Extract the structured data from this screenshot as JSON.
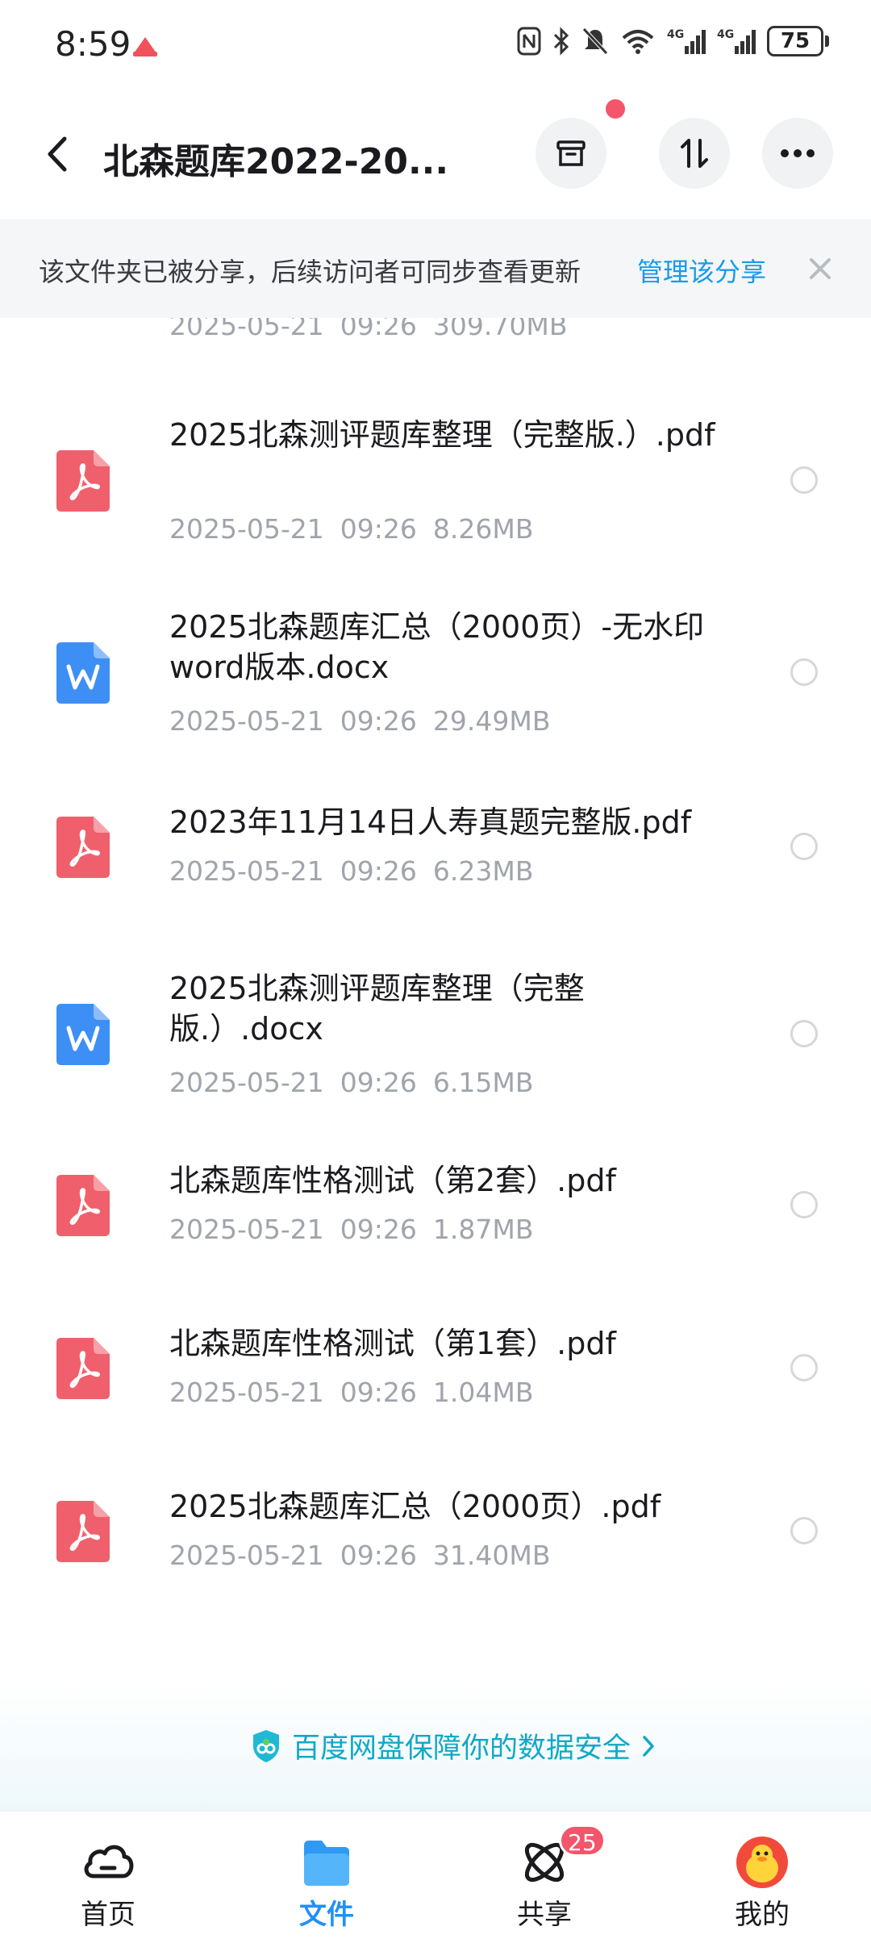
{
  "status_bar": {
    "time": "8:59",
    "battery": "75",
    "net1": "4G",
    "net2": "4G"
  },
  "header": {
    "title": "北森题库2022-20..."
  },
  "share_banner": {
    "text": "该文件夹已被分享，后续访问者可同步查看更新",
    "manage_label": "管理该分享"
  },
  "files": [
    {
      "type": "pdf",
      "name": "",
      "date": "2025-05-21",
      "time": "09:26",
      "size": "309.70MB"
    },
    {
      "type": "pdf",
      "name": "2025北森测评题库整理（完整版.）.pdf",
      "date": "2025-05-21",
      "time": "09:26",
      "size": "8.26MB"
    },
    {
      "type": "docx",
      "name": "2025北森题库汇总（2000页）-无水印word版本.docx",
      "date": "2025-05-21",
      "time": "09:26",
      "size": "29.49MB"
    },
    {
      "type": "pdf",
      "name": "2023年11月14日人寿真题完整版.pdf",
      "date": "2025-05-21",
      "time": "09:26",
      "size": "6.23MB"
    },
    {
      "type": "docx",
      "name": "2025北森测评题库整理（完整版.）.docx",
      "date": "2025-05-21",
      "time": "09:26",
      "size": "6.15MB"
    },
    {
      "type": "pdf",
      "name": "北森题库性格测试（第2套）.pdf",
      "date": "2025-05-21",
      "time": "09:26",
      "size": "1.87MB"
    },
    {
      "type": "pdf",
      "name": "北森题库性格测试（第1套）.pdf",
      "date": "2025-05-21",
      "time": "09:26",
      "size": "1.04MB"
    },
    {
      "type": "pdf",
      "name": "2025北森题库汇总（2000页）.pdf",
      "date": "2025-05-21",
      "time": "09:26",
      "size": "31.40MB"
    }
  ],
  "security": {
    "text": "百度网盘保障你的数据安全"
  },
  "nav": {
    "home": "首页",
    "files": "文件",
    "share": "共享",
    "share_badge": "25",
    "mine": "我的"
  },
  "colors": {
    "accent": "#2290f6",
    "link": "#1a9be8",
    "pdf": "#f0606c",
    "docx": "#3d8ff5",
    "badge": "#f3556a"
  }
}
